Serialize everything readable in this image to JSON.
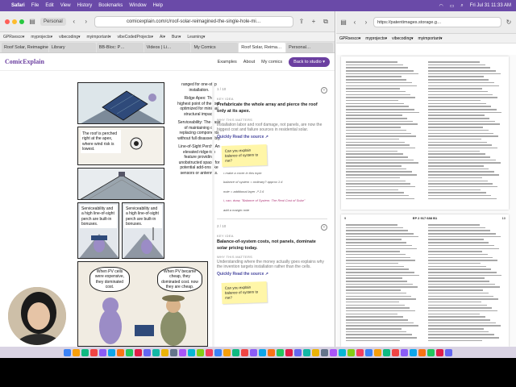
{
  "menubar": {
    "app": "Safari",
    "items": [
      "File",
      "Edit",
      "View",
      "History",
      "Bookmarks",
      "Window",
      "Help"
    ],
    "clock": "Fri Jul 31  11:33 AM"
  },
  "left_window": {
    "profile": "Personal",
    "url": "comicexplain.com/c/roof-solar-reimagined-the-single-hole-mi…",
    "bookmarks": [
      "GPRsesco▾",
      "myprojects▾",
      "vibecoding▾",
      "myimportant▾",
      "vibeCodedProjects▾",
      "Ai▾",
      "Bun▾",
      "Learning▾"
    ],
    "tabs": [
      "Roof Solar, Reimagine…",
      "Library",
      "BB-Bloc: P…",
      "Videos | Li…",
      "My Comics",
      "Roof Solar, Reima…",
      "Personal…"
    ],
    "site": {
      "logo": "ComicExplain",
      "nav": [
        "Examples",
        "About",
        "My comics"
      ],
      "cta": "Back to studio ▾"
    },
    "comic": {
      "captions": [
        "Ridge Apex: The highest point of the roof, optimized for minimal structural impact.",
        "Serviceability: The ease of maintaining or replacing components without full disassembly.",
        "Line-of-Sight Perch: An elevated ridge-top feature providing unobstructed space for potential add-ons like sensors or antennas."
      ],
      "top_caption_fragment": "ranged for one-step installation.",
      "panel_texts": [
        "The roof is perched right at the apex, where wind risk is lowest.",
        "Serviceability and a high line-of-sight perch are built-in bonuses.",
        "Serviceability and a high line-of-sight perch are built-in bonuses."
      ],
      "bubbles": [
        "When PV cells were expensive, they dominated cost.",
        "When PV became cheap, they dominated cost. now they are cheap."
      ]
    },
    "notes": [
      {
        "num": "1 / 10",
        "label": "KEY IDEA",
        "title": "Prefabricate the whole array and pierce the roof only at its apex.",
        "why_label": "WHY THIS MATTERS",
        "why": "Installation labor and roof damage, not panels, are now the biggest cost and failure sources in residential solar.",
        "source": "Quickly Read the source ↗",
        "sticky": "Can you explain balance of system to me?",
        "hand": [
          "• make a cover in this topic",
          "balance of system = ordinary? approx 1:4",
          "note = additional layer ↗ 2.6",
          "i, can, draw, \"Balance of System: The Real Cost of Solar\"",
          "add a margin note"
        ]
      },
      {
        "num": "2 / 10",
        "label": "KEY IDEA",
        "title": "Balance-of-system costs, not panels, dominate solar pricing today.",
        "why_label": "WHY THIS MATTERS",
        "why": "Understanding where the money actually goes explains why the invention targets installation rather than the cells.",
        "source": "Quickly Read the source ↗",
        "sticky": "Can you explain balance of system to me?"
      }
    ]
  },
  "right_window": {
    "url": "https://patentimages.storage.g…",
    "bookmarks": [
      "GPRsesco▾",
      "myprojects▾",
      "vibecoding▾",
      "myimportant▾"
    ],
    "page_header": "EP 2 917 688 B1",
    "page_num_left": "9",
    "page_num_right": "10"
  },
  "colors": {
    "menubar": "#6a4aa8",
    "brand": "#6b3fa0",
    "sticky": "#fff6a8"
  }
}
